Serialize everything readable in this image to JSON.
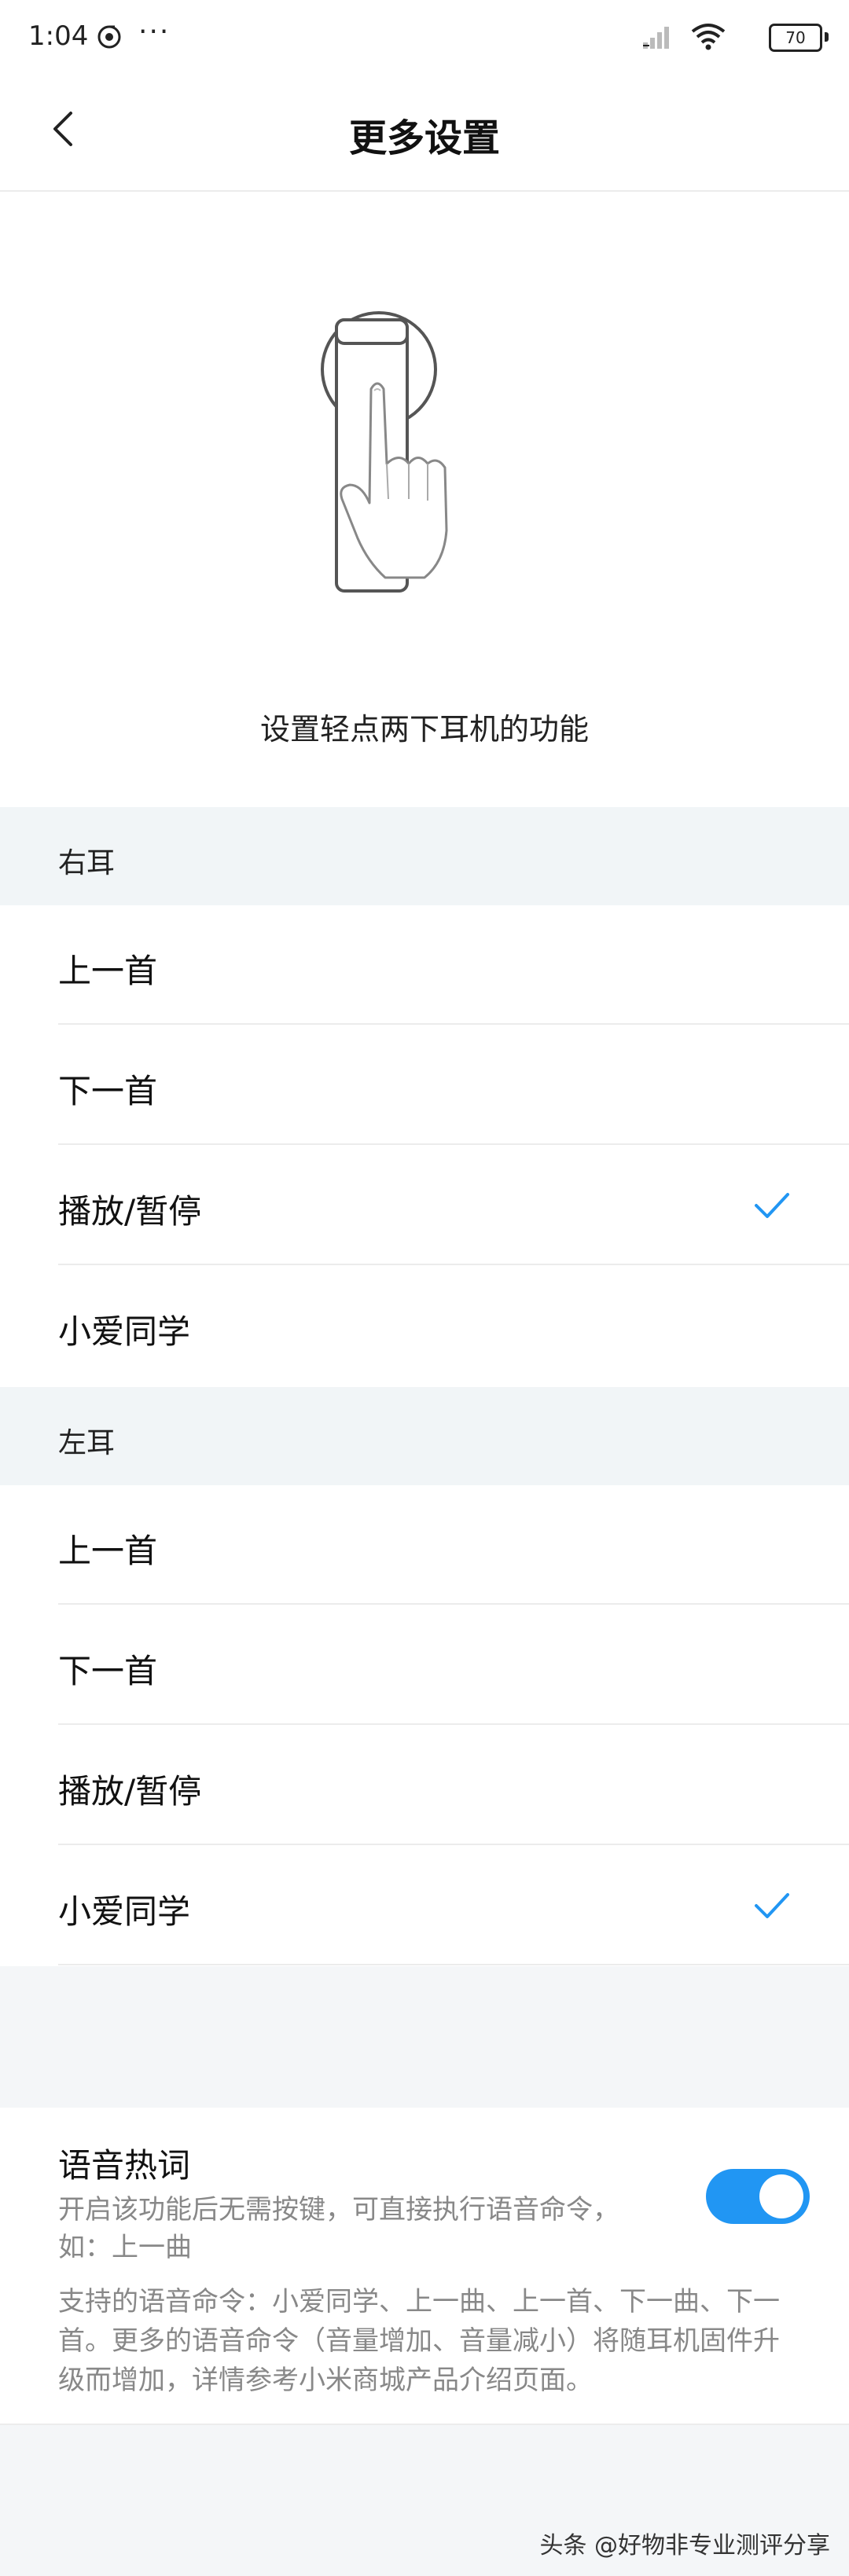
{
  "status_bar": {
    "time": "1:04",
    "more": "···",
    "battery": "70"
  },
  "header": {
    "title": "更多设置"
  },
  "illustration": {
    "caption": "设置轻点两下耳机的功能"
  },
  "right_ear": {
    "title": "右耳",
    "options": [
      {
        "label": "上一首",
        "selected": false
      },
      {
        "label": "下一首",
        "selected": false
      },
      {
        "label": "播放/暂停",
        "selected": true
      },
      {
        "label": "小爱同学",
        "selected": false
      }
    ]
  },
  "left_ear": {
    "title": "左耳",
    "options": [
      {
        "label": "上一首",
        "selected": false
      },
      {
        "label": "下一首",
        "selected": false
      },
      {
        "label": "播放/暂停",
        "selected": false
      },
      {
        "label": "小爱同学",
        "selected": true
      }
    ]
  },
  "hotword": {
    "title": "语音热词",
    "description": "开启该功能后无需按键，可直接执行语音命令，如：上一曲",
    "enabled": true,
    "note": "支持的语音命令：小爱同学、上一曲、上一首、下一曲、下一首。更多的语音命令（音量增加、音量减小）将随耳机固件升级而增加，详情参考小米商城产品介绍页面。"
  },
  "watermark": "头条 @好物非专业测评分享",
  "colors": {
    "accent": "#2196f3",
    "section_bg": "#f1f5f7",
    "secondary_text": "#888888"
  }
}
